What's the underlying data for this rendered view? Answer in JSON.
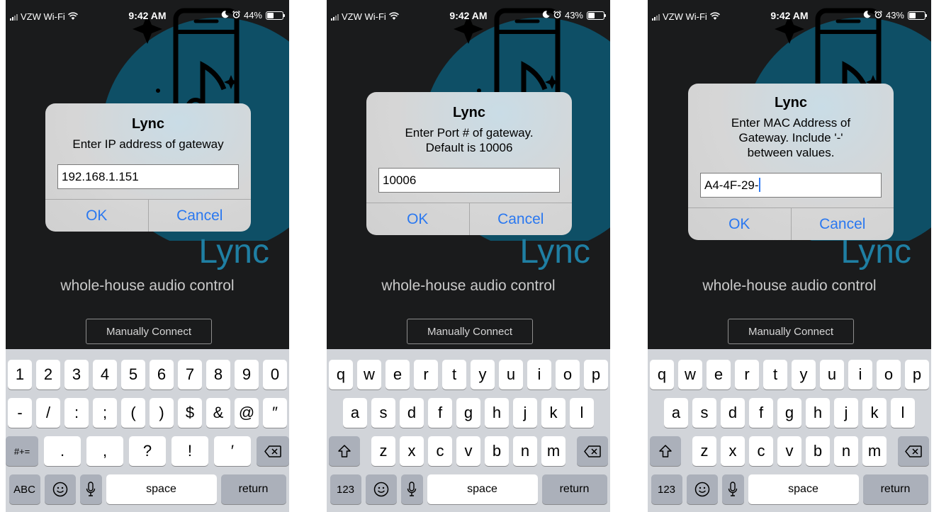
{
  "accent_color": "#1f7fa3",
  "link_color": "#2a78f0",
  "screens": [
    {
      "status": {
        "carrier": "VZW Wi-Fi",
        "time": "9:42 AM",
        "battery": "44%",
        "battery_level": 0.44
      },
      "brand": "Lync",
      "tagline": "whole-house audio control",
      "manual_connect": "Manually Connect",
      "alert": {
        "title": "Lync",
        "message": "Enter IP address of gateway",
        "input_value": "192.168.1.151",
        "ok": "OK",
        "cancel": "Cancel"
      },
      "keyboard": {
        "row1": [
          "1",
          "2",
          "3",
          "4",
          "5",
          "6",
          "7",
          "8",
          "9",
          "0"
        ],
        "row2": [
          "-",
          "/",
          ":",
          ";",
          "(",
          ")",
          "$",
          "&",
          "@",
          "″"
        ],
        "row3_left": "#+=",
        "row3": [
          ".",
          ",",
          "?",
          "!",
          "′"
        ],
        "mode_key": "ABC",
        "space": "space",
        "return": "return"
      }
    },
    {
      "status": {
        "carrier": "VZW Wi-Fi",
        "time": "9:42 AM",
        "battery": "43%",
        "battery_level": 0.43
      },
      "brand": "Lync",
      "tagline": "whole-house audio control",
      "manual_connect": "Manually Connect",
      "alert": {
        "title": "Lync",
        "message": "Enter Port # of gateway.\nDefault is 10006",
        "input_value": "10006",
        "ok": "OK",
        "cancel": "Cancel"
      },
      "keyboard": {
        "row1": [
          "q",
          "w",
          "e",
          "r",
          "t",
          "y",
          "u",
          "i",
          "o",
          "p"
        ],
        "row2": [
          "a",
          "s",
          "d",
          "f",
          "g",
          "h",
          "j",
          "k",
          "l"
        ],
        "row3": [
          "z",
          "x",
          "c",
          "v",
          "b",
          "n",
          "m"
        ],
        "mode_key": "123",
        "space": "space",
        "return": "return"
      }
    },
    {
      "status": {
        "carrier": "VZW Wi-Fi",
        "time": "9:42 AM",
        "battery": "43%",
        "battery_level": 0.43
      },
      "brand": "Lync",
      "tagline": "whole-house audio control",
      "manual_connect": "Manually Connect",
      "alert": {
        "title": "Lync",
        "message": "Enter MAC Address of\nGateway. Include '-'\nbetween values.",
        "input_value": "A4-4F-29-",
        "ok": "OK",
        "cancel": "Cancel"
      },
      "keyboard": {
        "row1": [
          "q",
          "w",
          "e",
          "r",
          "t",
          "y",
          "u",
          "i",
          "o",
          "p"
        ],
        "row2": [
          "a",
          "s",
          "d",
          "f",
          "g",
          "h",
          "j",
          "k",
          "l"
        ],
        "row3": [
          "z",
          "x",
          "c",
          "v",
          "b",
          "n",
          "m"
        ],
        "mode_key": "123",
        "space": "space",
        "return": "return"
      }
    }
  ]
}
